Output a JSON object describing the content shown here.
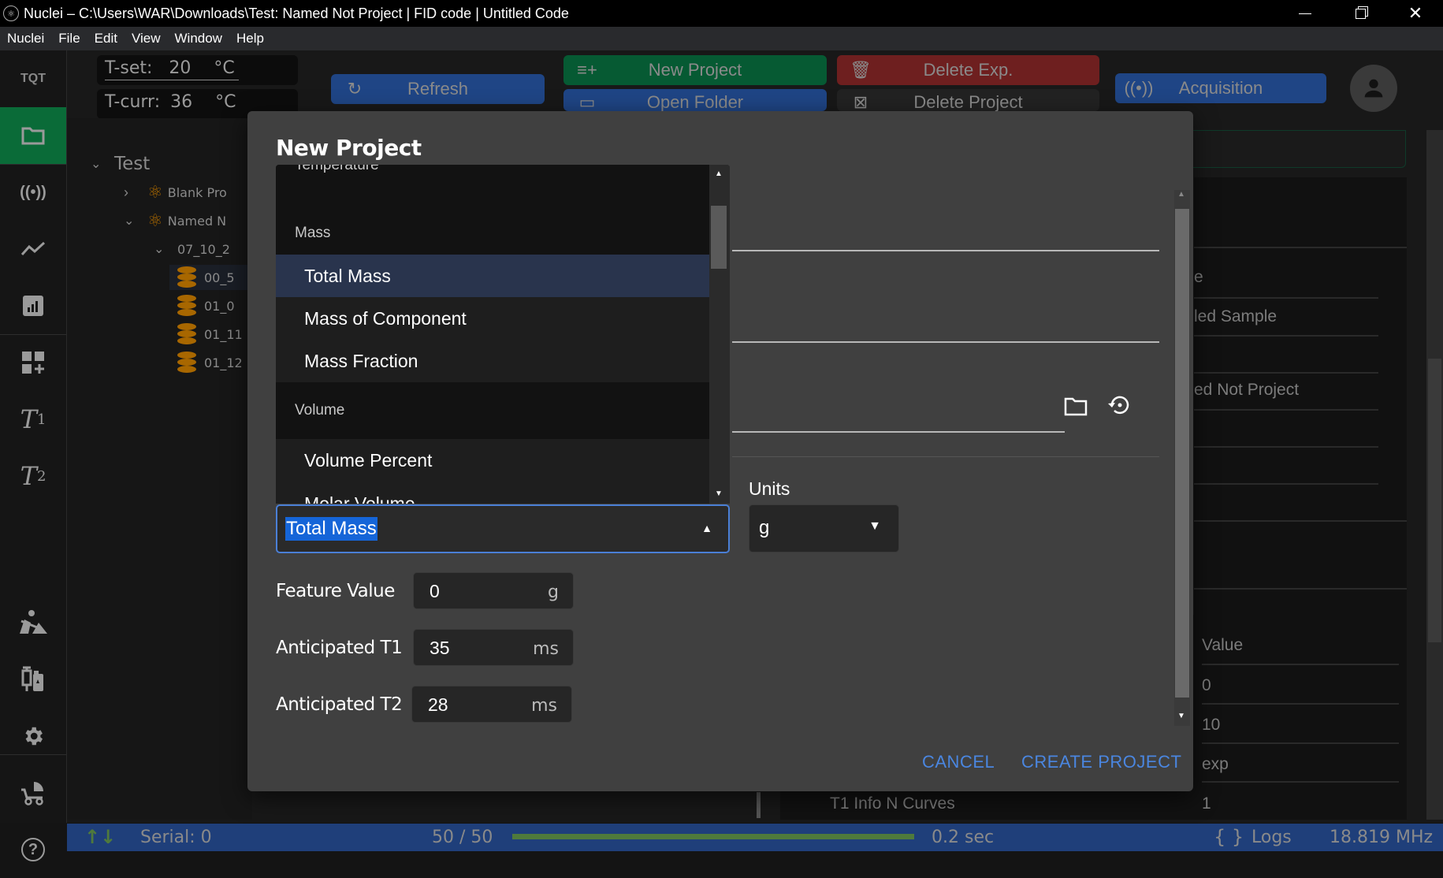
{
  "window": {
    "title": "Nuclei – C:\\Users\\WAR\\Downloads\\Test: Named Not Project | FID code | Untitled Code",
    "minimize": "—",
    "restore": "❐",
    "close": "✕"
  },
  "menu": [
    "Nuclei",
    "File",
    "Edit",
    "View",
    "Window",
    "Help"
  ],
  "temperature": {
    "set_label": "T-set:",
    "set_value": "20",
    "set_unit": "°C",
    "curr_label": "T-curr:",
    "curr_value": "36",
    "curr_unit": "°C"
  },
  "toolbar": {
    "refresh": "Refresh",
    "new_project": "New Project",
    "open_folder": "Open Folder",
    "delete_exp": "Delete Exp.",
    "delete_project": "Delete Project",
    "acquisition": "Acquisition"
  },
  "sidebar": {
    "logo": "TQT",
    "items": [
      {
        "name": "projects",
        "icon": "folder-icon"
      },
      {
        "name": "acquisition",
        "icon": "broadcast-icon"
      },
      {
        "name": "plot",
        "icon": "line-chart-icon"
      },
      {
        "name": "analytics",
        "icon": "bar-chart-icon"
      },
      {
        "name": "add-widget",
        "icon": "dashboard-add-icon"
      },
      {
        "name": "t1",
        "label": "T",
        "sub": "1"
      },
      {
        "name": "t2",
        "label": "T",
        "sub": "2"
      },
      {
        "name": "construction",
        "icon": "construction-icon"
      },
      {
        "name": "sample-prep",
        "icon": "vaccine-icon"
      },
      {
        "name": "settings",
        "icon": "gear-icon"
      },
      {
        "name": "stroller",
        "icon": "stroller-icon"
      },
      {
        "name": "help",
        "icon": "help-icon"
      }
    ]
  },
  "tree": {
    "root": "Test",
    "projects": [
      {
        "label": "Blank Pro",
        "expanded": false
      },
      {
        "label": "Named N",
        "expanded": true
      }
    ],
    "folder": "07_10_2",
    "experiments": [
      "00_5",
      "01_0",
      "01_11",
      "01_12"
    ]
  },
  "modal": {
    "title": "New Project",
    "dropdown": {
      "partial_top": "Temperature",
      "groups": [
        {
          "label": "Mass",
          "options": [
            "Total Mass",
            "Mass of Component",
            "Mass Fraction"
          ]
        },
        {
          "label": "Volume",
          "options": [
            "Volume Percent",
            "Molar Volume"
          ]
        }
      ],
      "selected": "Total Mass"
    },
    "feature_select_value": "Total Mass",
    "units_label": "Units",
    "units_value": "g",
    "fields": [
      {
        "label": "Feature Value",
        "value": "0",
        "unit": "g"
      },
      {
        "label": "Anticipated T1",
        "value": "35",
        "unit": "ms"
      },
      {
        "label": "Anticipated T2",
        "value": "28",
        "unit": "ms"
      }
    ],
    "cancel": "CANCEL",
    "create": "CREATE PROJECT"
  },
  "right_panel": {
    "partial_rows": [
      "e",
      "led Sample",
      "",
      "ed Not Project"
    ],
    "value_header": "Value",
    "rows": [
      {
        "key": "",
        "value": "0"
      },
      {
        "key": "",
        "value": "10"
      },
      {
        "key": "",
        "value": "exp"
      },
      {
        "key": "T1 Info N Curves",
        "value": "1"
      }
    ]
  },
  "status": {
    "serial": "Serial: 0",
    "progress_text": "50 / 50",
    "progress_fraction": 1.0,
    "time": "0.2 sec",
    "logs": "Logs",
    "frequency": "18.819 MHz"
  },
  "colors": {
    "accent_blue": "#1f4585",
    "accent_green": "#065a33",
    "accent_red": "#6e1f1f",
    "link_blue": "#4a86e0",
    "tree_gold": "#a86700",
    "progress_green": "#4f7a3c"
  }
}
